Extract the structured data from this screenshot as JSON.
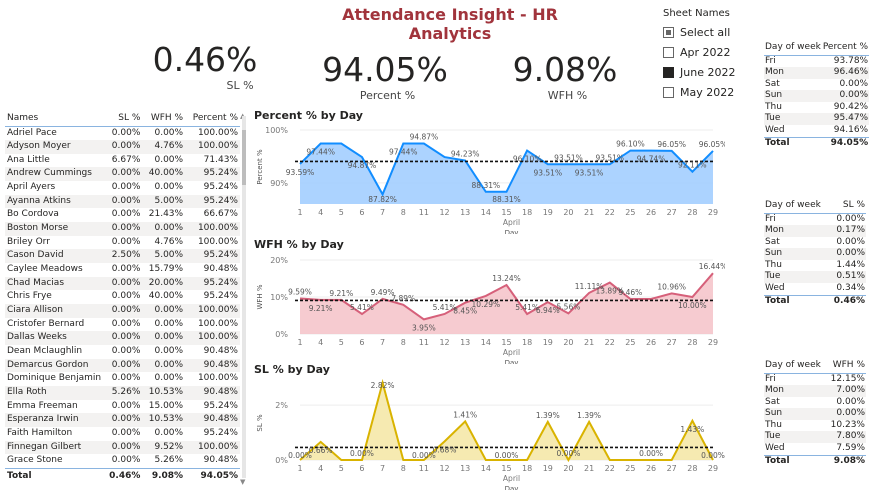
{
  "header": {
    "title": "Attendance Insight - HR Analytics"
  },
  "kpis": [
    {
      "value": "0.46%",
      "label": "SL %"
    },
    {
      "value": "94.05%",
      "label": "Percent %"
    },
    {
      "value": "9.08%",
      "label": "WFH %"
    }
  ],
  "slicer": {
    "title": "Sheet Names",
    "items": [
      {
        "label": "Select all",
        "state": "partial"
      },
      {
        "label": "Apr 2022",
        "state": "off"
      },
      {
        "label": "June 2022",
        "state": "on"
      },
      {
        "label": "May 2022",
        "state": "off"
      }
    ]
  },
  "names_table": {
    "headers": [
      "Names",
      "SL %",
      "WFH %",
      "Percent %"
    ],
    "rows": [
      [
        "Adriel Pace",
        "0.00%",
        "0.00%",
        "100.00%"
      ],
      [
        "Adyson Moyer",
        "0.00%",
        "4.76%",
        "100.00%"
      ],
      [
        "Ana Little",
        "6.67%",
        "0.00%",
        "71.43%"
      ],
      [
        "Andrew Cummings",
        "0.00%",
        "40.00%",
        "95.24%"
      ],
      [
        "April Ayers",
        "0.00%",
        "0.00%",
        "95.24%"
      ],
      [
        "Ayanna Atkins",
        "0.00%",
        "5.00%",
        "95.24%"
      ],
      [
        "Bo Cordova",
        "0.00%",
        "21.43%",
        "66.67%"
      ],
      [
        "Boston Morse",
        "0.00%",
        "0.00%",
        "100.00%"
      ],
      [
        "Briley Orr",
        "0.00%",
        "4.76%",
        "100.00%"
      ],
      [
        "Cason David",
        "2.50%",
        "5.00%",
        "95.24%"
      ],
      [
        "Caylee Meadows",
        "0.00%",
        "15.79%",
        "90.48%"
      ],
      [
        "Chad Macias",
        "0.00%",
        "20.00%",
        "95.24%"
      ],
      [
        "Chris Frye",
        "0.00%",
        "40.00%",
        "95.24%"
      ],
      [
        "Ciara Allison",
        "0.00%",
        "0.00%",
        "100.00%"
      ],
      [
        "Cristofer Bernard",
        "0.00%",
        "0.00%",
        "100.00%"
      ],
      [
        "Dallas Weeks",
        "0.00%",
        "0.00%",
        "100.00%"
      ],
      [
        "Dean Mclaughlin",
        "0.00%",
        "0.00%",
        "90.48%"
      ],
      [
        "Demarcus Gordon",
        "0.00%",
        "0.00%",
        "90.48%"
      ],
      [
        "Dominique Benjamin",
        "0.00%",
        "0.00%",
        "100.00%"
      ],
      [
        "Ella Roth",
        "5.26%",
        "10.53%",
        "90.48%"
      ],
      [
        "Emma Freeman",
        "0.00%",
        "15.00%",
        "95.24%"
      ],
      [
        "Esperanza Irwin",
        "0.00%",
        "10.53%",
        "90.48%"
      ],
      [
        "Faith Hamilton",
        "0.00%",
        "0.00%",
        "95.24%"
      ],
      [
        "Finnegan Gilbert",
        "0.00%",
        "9.52%",
        "100.00%"
      ],
      [
        "Grace Stone",
        "0.00%",
        "5.26%",
        "90.48%"
      ]
    ],
    "total": [
      "Total",
      "0.46%",
      "9.08%",
      "94.05%"
    ]
  },
  "dow_tables": [
    {
      "headers": [
        "Day of week",
        "Percent %"
      ],
      "rows": [
        [
          "Fri",
          "93.78%"
        ],
        [
          "Mon",
          "96.46%"
        ],
        [
          "Sat",
          "0.00%"
        ],
        [
          "Sun",
          "0.00%"
        ],
        [
          "Thu",
          "90.42%"
        ],
        [
          "Tue",
          "95.47%"
        ],
        [
          "Wed",
          "94.16%"
        ]
      ],
      "total": [
        "Total",
        "94.05%"
      ]
    },
    {
      "headers": [
        "Day of week",
        "SL %"
      ],
      "rows": [
        [
          "Fri",
          "0.00%"
        ],
        [
          "Mon",
          "0.17%"
        ],
        [
          "Sat",
          "0.00%"
        ],
        [
          "Sun",
          "0.00%"
        ],
        [
          "Thu",
          "1.44%"
        ],
        [
          "Tue",
          "0.51%"
        ],
        [
          "Wed",
          "0.34%"
        ]
      ],
      "total": [
        "Total",
        "0.46%"
      ]
    },
    {
      "headers": [
        "Day of week",
        "WFH %"
      ],
      "rows": [
        [
          "Fri",
          "12.15%"
        ],
        [
          "Mon",
          "7.00%"
        ],
        [
          "Sat",
          "0.00%"
        ],
        [
          "Sun",
          "0.00%"
        ],
        [
          "Thu",
          "10.23%"
        ],
        [
          "Tue",
          "7.80%"
        ],
        [
          "Wed",
          "7.59%"
        ]
      ],
      "total": [
        "Total",
        "9.08%"
      ]
    }
  ],
  "chart_data": [
    {
      "type": "area",
      "title": "Percent % by Day",
      "xlabel": "Day",
      "ylabel": "Percent %",
      "x_group_label": "April",
      "x": [
        1,
        4,
        5,
        6,
        7,
        8,
        11,
        12,
        13,
        14,
        15,
        18,
        19,
        20,
        21,
        22,
        25,
        26,
        27,
        28,
        29
      ],
      "values": [
        93.59,
        97.44,
        97.44,
        94.87,
        87.82,
        97.44,
        97.44,
        94.87,
        94.23,
        88.31,
        88.31,
        96.1,
        93.51,
        93.51,
        93.51,
        93.51,
        96.1,
        96.1,
        96.05,
        92.11,
        96.05
      ],
      "point_labels": [
        "93.59%",
        "97.44%",
        "",
        "94.87%",
        "87.82%",
        "97.44%",
        "94.87%",
        "",
        "94.23%",
        "88.31%",
        "88.31%",
        "96.10%",
        "93.51%",
        "93.51%",
        "93.51%",
        "93.51%",
        "96.10%",
        "94.74%",
        "96.05%",
        "92.11%",
        "96.05%"
      ],
      "average": 94.05,
      "ylim": [
        86,
        100
      ],
      "yticks": [
        "100%",
        "90%"
      ],
      "ytick_values": [
        100,
        90
      ],
      "color": "#118dff",
      "fill": "#9ecbff"
    },
    {
      "type": "area",
      "title": "WFH % by Day",
      "xlabel": "Day",
      "ylabel": "WFH %",
      "x_group_label": "April",
      "x": [
        1,
        4,
        5,
        6,
        7,
        8,
        11,
        12,
        13,
        14,
        15,
        18,
        19,
        20,
        21,
        22,
        25,
        26,
        27,
        28,
        29
      ],
      "values": [
        9.59,
        9.21,
        9.21,
        5.41,
        9.49,
        7.89,
        3.95,
        5.41,
        8.45,
        10.29,
        13.24,
        5.41,
        8.61,
        5.56,
        11.11,
        13.89,
        9.46,
        9.46,
        10.96,
        10.0,
        16.44
      ],
      "point_labels": [
        "9.59%",
        "9.21%",
        "9.21%",
        "5.41%",
        "9.49%",
        "7.89%",
        "3.95%",
        "5.41%",
        "8.45%",
        "10.29%",
        "13.24%",
        "5.41%",
        "6.94%",
        "5.56%",
        "11.11%",
        "13.89%",
        "9.46%",
        "",
        "10.96%",
        "10.00%",
        "16.44%"
      ],
      "average": 9.08,
      "ylim": [
        0,
        20
      ],
      "yticks": [
        "20%",
        "10%",
        "0%"
      ],
      "ytick_values": [
        20,
        10,
        0
      ],
      "color": "#d6607a",
      "fill": "#f4c2c8"
    },
    {
      "type": "area",
      "title": "SL % by Day",
      "xlabel": "Day",
      "ylabel": "SL %",
      "x_group_label": "April",
      "x": [
        1,
        4,
        5,
        6,
        7,
        8,
        11,
        12,
        13,
        14,
        15,
        18,
        19,
        20,
        21,
        22,
        25,
        26,
        27,
        28,
        29
      ],
      "values": [
        0.0,
        0.66,
        0.0,
        0.0,
        2.82,
        0.0,
        0.0,
        0.68,
        1.41,
        0.0,
        0.0,
        0.0,
        1.39,
        0.0,
        1.39,
        0.0,
        0.0,
        0.0,
        0.0,
        1.43,
        0.0
      ],
      "point_labels": [
        "0.00%",
        "0.66%",
        "",
        "0.00%",
        "2.82%",
        "",
        "0.00%",
        "0.68%",
        "1.41%",
        "",
        "0.00%",
        "",
        "1.39%",
        "0.00%",
        "1.39%",
        "",
        "",
        "0.00%",
        "",
        "1.43%",
        "0.00%"
      ],
      "average": 0.46,
      "ylim": [
        0,
        2.7
      ],
      "yticks": [
        "2%",
        "0%"
      ],
      "ytick_values": [
        2,
        0
      ],
      "color": "#d9b300",
      "fill": "#f5e6a3"
    }
  ]
}
